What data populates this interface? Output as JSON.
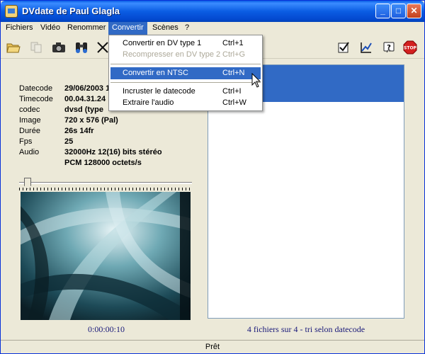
{
  "window": {
    "title": "DVdate de Paul Glagla",
    "minimize": "_",
    "maximize": "□",
    "close": "✕"
  },
  "menubar": [
    "Fichiers",
    "Vidéo",
    "Renommer",
    "Convertir",
    "Scènes",
    "?"
  ],
  "convert_menu": {
    "items": [
      {
        "label": "Convertir en DV type 1",
        "shortcut": "Ctrl+1"
      },
      {
        "label": "Recompresser en DV type 2",
        "shortcut": "Ctrl+G"
      },
      {
        "label": "Convertir en NTSC",
        "shortcut": "Ctrl+N"
      },
      {
        "label": "Incruster le datecode",
        "shortcut": "Ctrl+I"
      },
      {
        "label": "Extraire l'audio",
        "shortcut": "Ctrl+W"
      }
    ]
  },
  "info": {
    "datecode": {
      "label": "Datecode",
      "value": "29/06/2003 1"
    },
    "timecode": {
      "label": "Timecode",
      "value": "00.04.31.24"
    },
    "codec": {
      "label": "codec",
      "value": "dvsd (type"
    },
    "image": {
      "label": "Image",
      "value": "720 x 576 (Pal)"
    },
    "duree": {
      "label": "Durée",
      "value": "26s 14fr"
    },
    "fps": {
      "label": "Fps",
      "value": "25"
    },
    "audio": {
      "label": "Audio",
      "value": "32000Hz 12(16) bits  stéréo",
      "value2": "PCM 128000 octets/s"
    }
  },
  "playback": {
    "timecode": "0:00:00:10",
    "position_fraction": 0.03
  },
  "file_status": "4 fichiers sur 4 - tri selon datecode",
  "statusbar": "Prêt",
  "icons": [
    "open-folder-icon",
    "copy-icon",
    "camera-icon",
    "binoculars-icon",
    "cut-icon",
    "check-icon",
    "graph-icon",
    "help-icon",
    "stop-icon"
  ]
}
